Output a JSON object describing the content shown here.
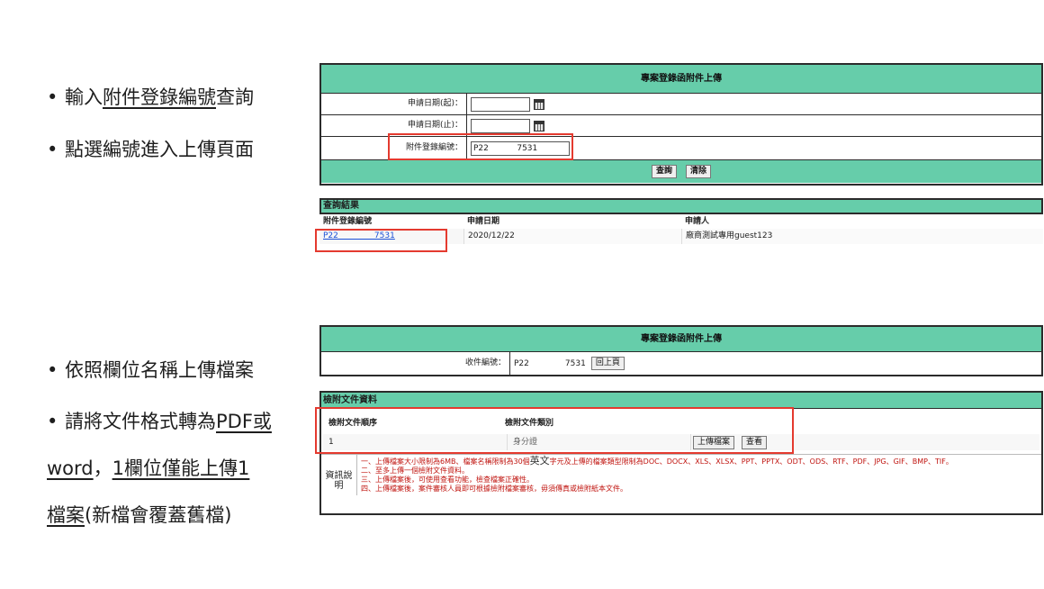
{
  "bullets_top": [
    {
      "pre": "輸入",
      "underlined": "附件登錄編號",
      "post": "查詢"
    },
    {
      "pre": "點選編號進入上傳頁面",
      "underlined": "",
      "post": ""
    }
  ],
  "bullets_bottom": {
    "item1": "依照欄位名稱上傳檔案",
    "item2_pre": "請將文件格式轉為",
    "item2_u1": "PDF或",
    "item2_line2_u": "word",
    "item2_line2_mid": "，",
    "item2_line2_u2": "1欄位僅能上傳1",
    "item2_line3_u": "檔案",
    "item2_line3_post": "(新檔會覆蓋舊檔)"
  },
  "search_form": {
    "title": "專案登錄函附件上傳",
    "start_label": "申請日期(起)：",
    "end_label": "申請日期(止)：",
    "id_label": "附件登錄編號：",
    "id_value": "P22           7531",
    "query_button": "查詢",
    "clear_button": "清除"
  },
  "results": {
    "title": "查詢結果",
    "headers": [
      "附件登錄編號",
      "申請日期",
      "申請人"
    ],
    "rows": [
      {
        "id": "P22              7531",
        "date": "2020/12/22",
        "applicant": "廠商測試專用guest123"
      }
    ]
  },
  "upload_form": {
    "title": "專案登錄函附件上傳",
    "receipt_label": "收件編號：",
    "receipt_value": "P22              7531",
    "back_button": "回上頁"
  },
  "documents": {
    "title": "檢附文件資料",
    "headers": [
      "檢附文件順序",
      "檢附文件類別"
    ],
    "row": {
      "order": "1",
      "type": "身分證",
      "upload_button": "上傳檔案",
      "view_button": "查看"
    },
    "info_label": "資訊說明",
    "info_line1_a": "一、上傳檔案大小限制為6MB、檔案名稱限制為30個",
    "info_line1_big": "英文",
    "info_line1_b": "字元及上傳的檔案類型限制為DOC、DOCX、XLS、XLSX、PPT、PPTX、ODT、ODS、RTF、PDF、JPG、GIF、BMP、TIF。",
    "info_lines": [
      "二、至多上傳一個檢附文件資料。",
      "三、上傳檔案後，可使用查看功能，檢查檔案正確性。",
      "四、上傳檔案後，案件審核人員即可根據檢附檔案審核，毋須傳真或檢附紙本文件。"
    ]
  }
}
